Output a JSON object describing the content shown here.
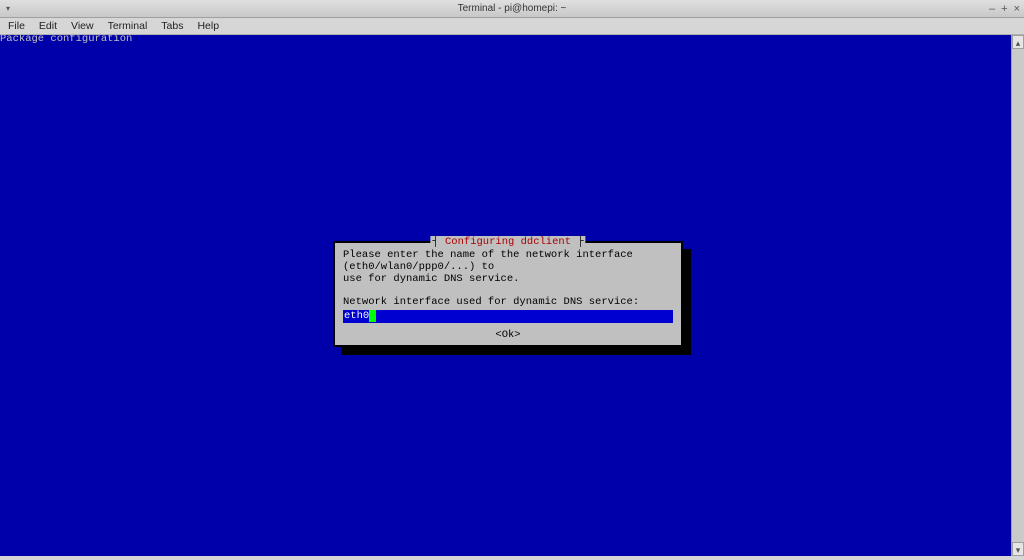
{
  "window": {
    "title": "Terminal - pi@homepi: ~",
    "app_menu_glyph": "▾"
  },
  "window_controls": {
    "minimize": "–",
    "maximize": "+",
    "close": "×"
  },
  "menu": {
    "file": "File",
    "edit": "Edit",
    "view": "View",
    "terminal": "Terminal",
    "tabs": "Tabs",
    "help": "Help"
  },
  "pkg_header": "Package configuration",
  "dialog": {
    "title": "Configuring ddclient",
    "line1": "Please enter the name of the network interface (eth0/wlan0/ppp0/...) to",
    "line2": "use for dynamic DNS service.",
    "prompt": "Network interface used for dynamic DNS service:",
    "input_value": "eth0",
    "ok_label": "<Ok>"
  },
  "scrollbar": {
    "up": "▴",
    "down": "▾"
  }
}
